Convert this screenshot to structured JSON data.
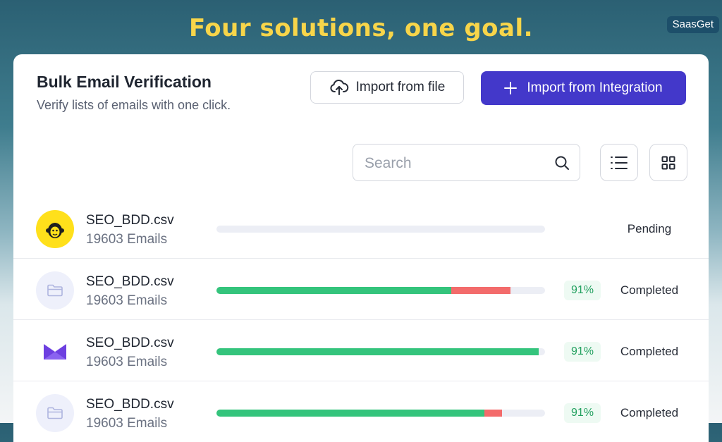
{
  "banner": {
    "headline": "Four solutions, one goal.",
    "brand": "SaasGet"
  },
  "header": {
    "title": "Bulk Email Verification",
    "subtitle": "Verify lists of emails with one click.",
    "import_file_label": "Import from file",
    "import_integration_label": "Import from Integration"
  },
  "search": {
    "placeholder": "Search"
  },
  "colors": {
    "accent": "#4338ca",
    "progress_valid": "#34c47c",
    "progress_invalid": "#f36b6b",
    "mailchimp_yellow": "#ffe01b"
  },
  "files": [
    {
      "name": "SEO_BDD.csv",
      "count": "19603 Emails",
      "source_icon": "mailchimp-icon",
      "progress": {
        "valid": 0,
        "invalid": 0
      },
      "percent": "",
      "status": "Pending"
    },
    {
      "name": "SEO_BDD.csv",
      "count": "19603 Emails",
      "source_icon": "folder-icon",
      "progress": {
        "valid": 0.715,
        "invalid": 0.18
      },
      "percent": "91%",
      "status": "Completed"
    },
    {
      "name": "SEO_BDD.csv",
      "count": "19603 Emails",
      "source_icon": "mail-service-icon",
      "progress": {
        "valid": 0.98,
        "invalid": 0
      },
      "percent": "91%",
      "status": "Completed"
    },
    {
      "name": "SEO_BDD.csv",
      "count": "19603 Emails",
      "source_icon": "folder-icon",
      "progress": {
        "valid": 0.815,
        "invalid": 0.055
      },
      "percent": "91%",
      "status": "Completed"
    }
  ]
}
